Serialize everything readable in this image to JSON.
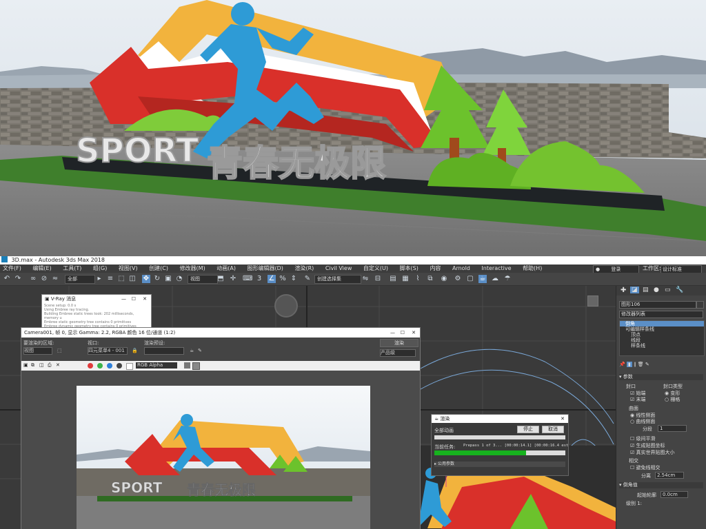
{
  "hero": {
    "sport_text": "SPORT",
    "slogan": "青春无极限"
  },
  "app": {
    "title": "3D.max - Autodesk 3ds Max 2018",
    "menus": [
      "文件(F)",
      "编辑(E)",
      "工具(T)",
      "组(G)",
      "视图(V)",
      "创建(C)",
      "修改器(M)",
      "动画(A)",
      "图形编辑器(D)",
      "渲染(R)",
      "Civil View",
      "自定义(U)",
      "脚本(S)",
      "内容",
      "Arnold",
      "Interactive",
      "帮助(H)"
    ],
    "login": "登录",
    "workspace_label": "工作区:",
    "workspace_value": "设计标准",
    "toolbar": {
      "all": "全部",
      "view": "视图",
      "selection_set": "创建选择集"
    }
  },
  "vray_log": {
    "title": "V-Ray 消息",
    "lines": [
      "Scene setup: 0.0 s",
      "Using Embree ray tracing.",
      "Building Embree static trees took: 202 milliseconds, memory u",
      "Embree static geometry tree contains 0 primitives",
      "Embree dynamic geometry tree contains 0 primitives"
    ]
  },
  "frame_buffer": {
    "title": "Camera001, 帧 0, 显示 Gamma: 2.2, RGBA 颜色 16 位/通道 (1:2)",
    "area_label": "要渲染的区域:",
    "area_value": "视图",
    "viewport_label": "视口:",
    "viewport_value": "四元菜单4 - 001",
    "preset_label": "渲染预设:",
    "preset_value": "",
    "render_button": "渲染",
    "product_value": "产品级",
    "channel": "RGB Alpha",
    "sport_text": "SPORT",
    "slogan": "青春无极限"
  },
  "render_dialog": {
    "title": "渲染",
    "all_anim": "全部动画",
    "pause": "停止",
    "cancel": "取消",
    "current_task_label": "当前任务:",
    "current_task_value": "Prepass 1 of 3... [00:00:14.1] [00:00:16.4 est",
    "progress": 0.7,
    "common_params": "公用参数"
  },
  "command_panel": {
    "object_name": "图形106",
    "modifier_list": "修改器列表",
    "stack": [
      "倒角",
      "可编辑样条线",
      "顶点",
      "线段",
      "样条线"
    ],
    "params_title": "参数",
    "caps_label": "封口",
    "caps_type_label": "封口类型",
    "start_cap": "始端",
    "end_cap": "末端",
    "morph": "变形",
    "grid": "栅格",
    "surface_label": "曲面",
    "linear_sides": "线性侧面",
    "curved_sides": "曲线侧面",
    "segments_label": "分段",
    "segments_value": "1",
    "smooth_across": "级间平滑",
    "gen_map": "生成贴图坐标",
    "real_world": "真实世界贴图大小",
    "intersect_label": "相交",
    "keep_lines": "避免线相交",
    "separation_label": "分离",
    "separation_value": "2.54cm",
    "bevel_values": "倒角值",
    "start_outline_label": "起始轮廓",
    "start_outline_value": "0.0cm",
    "level1_label": "级别 1:"
  },
  "colors": {
    "accent": "#5b8fc7",
    "red_arrow": "#d9302a",
    "yellow_arrow": "#f2b33d",
    "blue_runner": "#2e9bd6",
    "green": "#6cc22c"
  }
}
